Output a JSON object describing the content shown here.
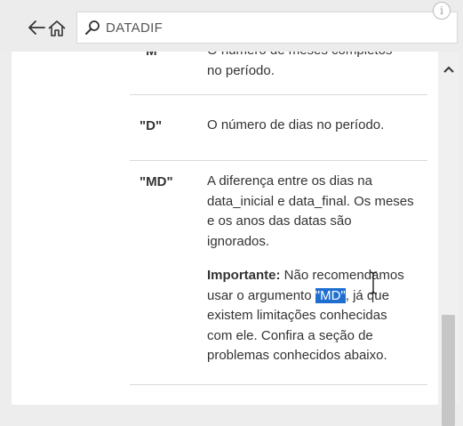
{
  "search": {
    "query": "DATADIF"
  },
  "rows": [
    {
      "code": "\"M\"",
      "description_lines": [
        "O número de meses completos",
        "no período."
      ]
    },
    {
      "code": "\"D\"",
      "description_lines": [
        "O número de dias no período."
      ]
    },
    {
      "code": "\"MD\"",
      "description_lines": [
        "A diferença entre os dias na",
        "data_inicial e data_final. Os meses",
        "e os anos das datas são",
        "ignorados."
      ]
    }
  ],
  "note": {
    "label": "Importante:",
    "line1_rest": " Não recomendamos",
    "line2_before": "usar o argumento ",
    "line2_selected": "\"MD\"",
    "line2_after": ", já que",
    "line3": "existem limitações conhecidas",
    "line4": "com ele. Confira a seção de",
    "line5": "problemas conhecidos abaixo."
  },
  "icons": {
    "back": "back-arrow-icon",
    "home": "home-icon",
    "search": "search-icon",
    "info": "info-icon",
    "scroll_up": "chevron-up-icon"
  },
  "colors": {
    "selection": "#1f6fd1",
    "background": "#ededed",
    "panel": "#ffffff"
  }
}
